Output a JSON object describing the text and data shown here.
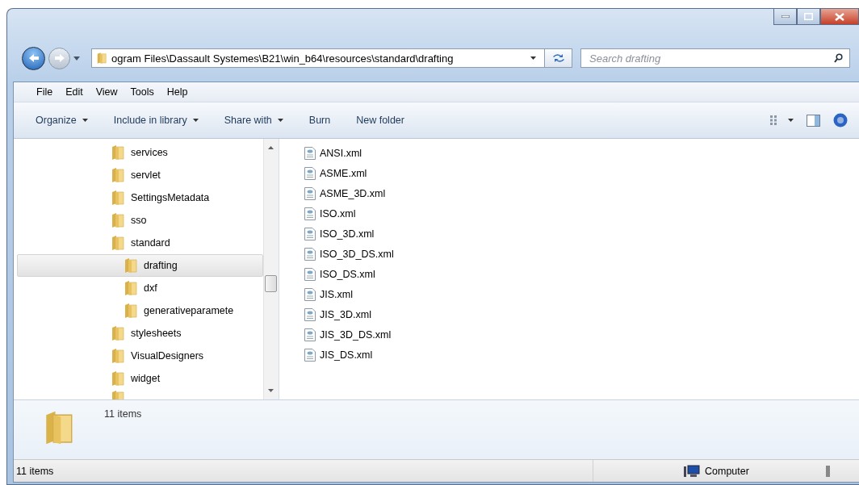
{
  "address": {
    "path": "ogram Files\\Dassault Systemes\\B21\\win_b64\\resources\\standard\\drafting"
  },
  "search": {
    "placeholder": "Search drafting"
  },
  "menu": [
    "File",
    "Edit",
    "View",
    "Tools",
    "Help"
  ],
  "toolbar": [
    {
      "label": "Organize",
      "dropdown": true
    },
    {
      "label": "Include in library",
      "dropdown": true
    },
    {
      "label": "Share with",
      "dropdown": true
    },
    {
      "label": "Burn",
      "dropdown": false
    },
    {
      "label": "New folder",
      "dropdown": false
    }
  ],
  "tree": [
    {
      "name": "services",
      "selected": false
    },
    {
      "name": "servlet",
      "selected": false
    },
    {
      "name": "SettingsMetadata",
      "selected": false
    },
    {
      "name": "sso",
      "selected": false
    },
    {
      "name": "standard",
      "selected": false,
      "children": [
        {
          "name": "drafting",
          "selected": true
        },
        {
          "name": "dxf",
          "selected": false
        },
        {
          "name": "generativeparamete",
          "selected": false
        }
      ]
    },
    {
      "name": "stylesheets",
      "selected": false
    },
    {
      "name": "VisualDesigners",
      "selected": false
    },
    {
      "name": "widget",
      "selected": false
    }
  ],
  "files": [
    "ANSI.xml",
    "ASME.xml",
    "ASME_3D.xml",
    "ISO.xml",
    "ISO_3D.xml",
    "ISO_3D_DS.xml",
    "ISO_DS.xml",
    "JIS.xml",
    "JIS_3D.xml",
    "JIS_3D_DS.xml",
    "JIS_DS.xml"
  ],
  "details": {
    "count": "11 items"
  },
  "status_bar": {
    "count": "11 items",
    "location": "Computer"
  }
}
